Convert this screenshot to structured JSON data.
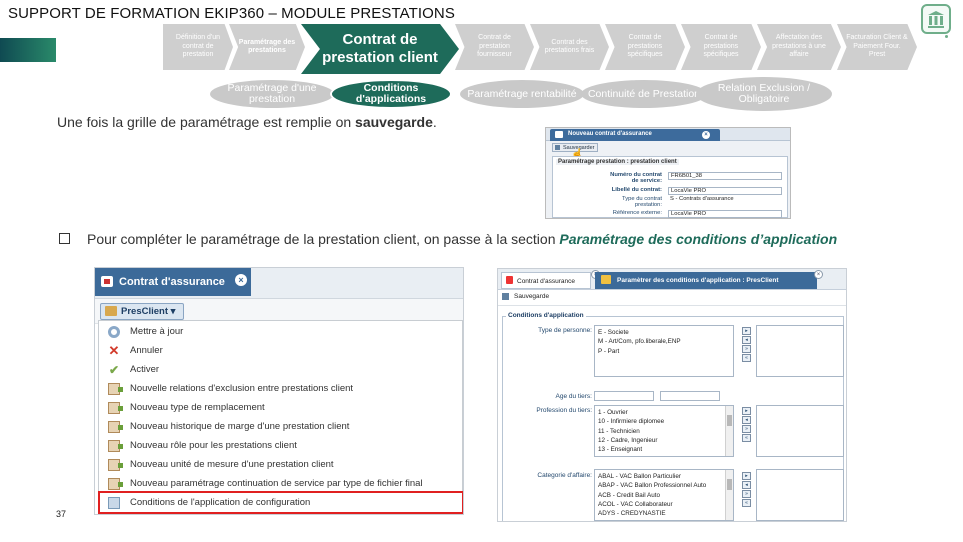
{
  "header": {
    "title": "SUPPORT DE FORMATION EKIP360 – MODULE PRESTATIONS"
  },
  "steps": [
    {
      "label": "Définition d'un contrat de prestation"
    },
    {
      "label": "Paramétrage des prestations"
    },
    {
      "label": "Contrat de prestation client"
    },
    {
      "label": "Contrat de prestation fournisseur"
    },
    {
      "label": "Contrat des prestations frais"
    },
    {
      "label": "Contrat de prestations spécifiques"
    },
    {
      "label": "Contrat de prestations spécifiques"
    },
    {
      "label": "Affectation des prestations à une affaire"
    },
    {
      "label": "Facturation Client & Paiement Four. Prest"
    }
  ],
  "substeps": [
    {
      "label": "Paramétrage d'une prestation"
    },
    {
      "label": "Conditions d'applications"
    },
    {
      "label": "Paramétrage rentabilité"
    },
    {
      "label": "Continuité de Prestation"
    },
    {
      "label": "Relation Exclusion / Obligatoire"
    }
  ],
  "content": {
    "intro_prefix": "Une fois la grille de paramétrage est remplie on ",
    "intro_bold": "sauvegarde",
    "intro_suffix": ".",
    "bullet_prefix": "Pour compléter le paramétrage de la prestation client, on passe à la section ",
    "bullet_emphasis": "Paramétrage des conditions d’application"
  },
  "page_number": "37",
  "screenshot_save": {
    "tab_title": "Nouveau contrat d'assurance",
    "save_button": "Sauvegarder",
    "section_title": "Paramétrage prestation : prestation client",
    "fields": [
      {
        "label": "Numéro du contrat de service:",
        "value": "FR6B01_38"
      },
      {
        "label": "Libellé du contrat:",
        "value": "LocaVie PRO"
      },
      {
        "label": "Type du contrat prestation:",
        "value": "S - Contrats d'assurance"
      },
      {
        "label": "Référence externe:",
        "value": "LocaVie PRO"
      }
    ]
  },
  "screenshot_menu": {
    "tab_title": "Contrat d'assurance",
    "dropdown_label": "PresClient ▾",
    "items": [
      {
        "label": "Mettre à jour",
        "icon": "refresh-icon"
      },
      {
        "label": "Annuler",
        "icon": "cancel-icon"
      },
      {
        "label": "Activer",
        "icon": "check-icon"
      },
      {
        "label": "Nouvelle relations d'exclusion entre prestations client",
        "icon": "new-icon"
      },
      {
        "label": "Nouveau type de remplacement",
        "icon": "new-icon"
      },
      {
        "label": "Nouveau historique de marge d'une prestation client",
        "icon": "new-icon"
      },
      {
        "label": "Nouveau rôle pour les prestations client",
        "icon": "new-icon"
      },
      {
        "label": "Nouveau unité de mesure d'une prestation client",
        "icon": "new-icon"
      },
      {
        "label": "Nouveau paramétrage continuation de service par type de fichier final",
        "icon": "new-icon"
      },
      {
        "label": "Conditions de l'application de configuration",
        "icon": "config-icon"
      }
    ],
    "highlight_color": "#e02020"
  },
  "screenshot_conditions": {
    "tab1_title": "Contrat d'assurance",
    "tab2_title": "Paramètrer des conditions d'application : PresClient",
    "save_button": "Sauvegarde",
    "section_title": "Conditions d'application",
    "type_personne_label": "Type de personne:",
    "type_personne_options": [
      "E - Societe",
      "M - Art/Com, pfo.liberale,ENP",
      "P - Part"
    ],
    "age_label": "Age du tiers:",
    "profession_label": "Profession du tiers:",
    "profession_options": [
      "1 - Ouvrier",
      "10 - Infirmiere diplomee",
      "11 - Technicien",
      "12 - Cadre, Ingenieur",
      "13 - Enseignant"
    ],
    "categorie_label": "Categorie d'affaire:",
    "categorie_options": [
      "ABAL - VAC Ballon Particulier",
      "ABAP - VAC Ballon Professionnel Auto",
      "ACB - Credit Bail Auto",
      "ACOL - VAC Collaborateur",
      "ADYS - CREDYNASTIE"
    ]
  },
  "colors": {
    "accent": "#1e6b5a",
    "step_inactive": "#cfcfcf",
    "tab_blue": "#3c6a99"
  }
}
